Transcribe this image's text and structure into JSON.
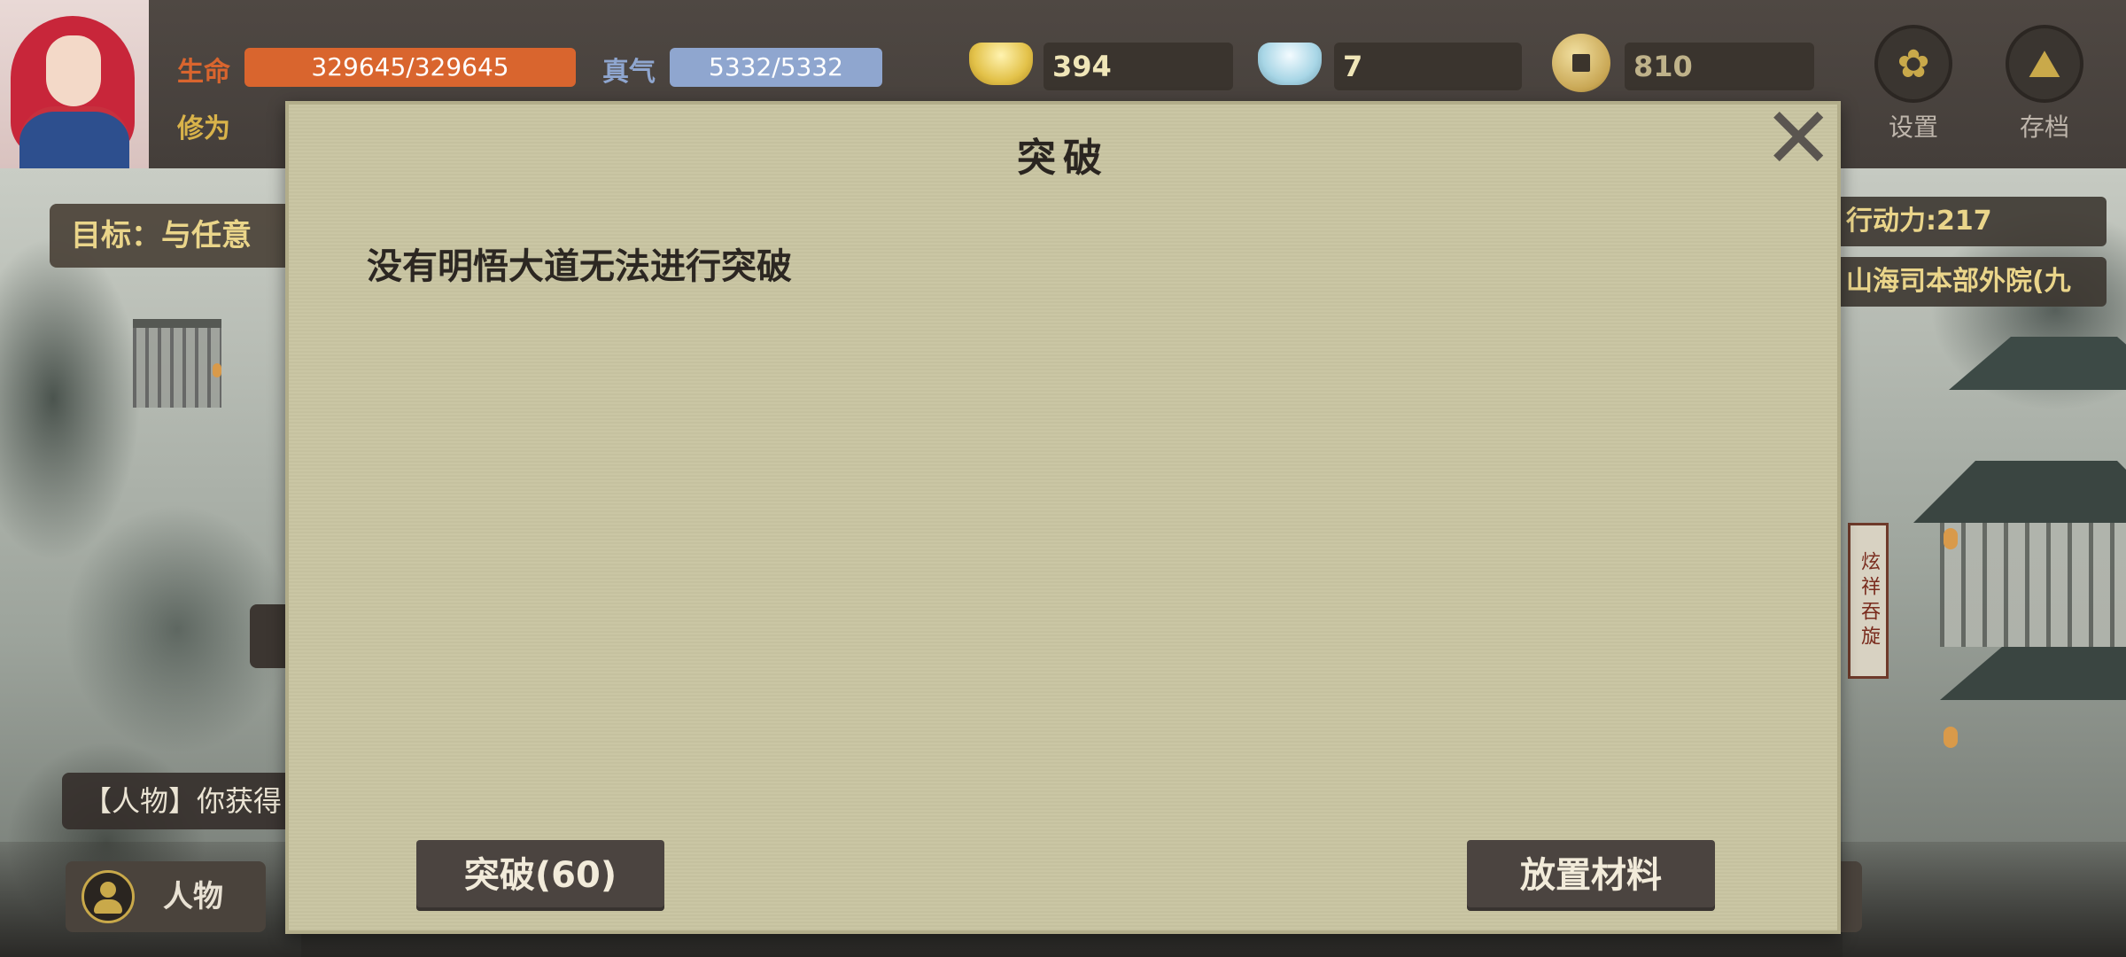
{
  "hud": {
    "hp_label": "生命",
    "hp_value": "329645/329645",
    "mp_label": "真气",
    "mp_value": "5332/5332",
    "cultivation_label": "修为",
    "gold": "394",
    "silver": "7",
    "coins": "810",
    "settings_label": "设置",
    "save_label": "存档"
  },
  "side": {
    "goal": "目标：与任意",
    "action_power": "行动力:217",
    "location": "山海司本部外院(九",
    "log": "【人物】你获得",
    "person_label": "人物",
    "banner": "炫祥吞旋"
  },
  "dialog": {
    "title": "突破",
    "message": "没有明悟大道无法进行突破",
    "close_symbol": "✕",
    "breakthrough_label": "突破(60)",
    "materials_label": "放置材料"
  },
  "colors": {
    "hp": "#d9652e",
    "mp": "#8fa6cf",
    "dialog_bg": "#c9c5a2",
    "button_bg": "#4b4440",
    "accent_gold": "#ead58a"
  }
}
